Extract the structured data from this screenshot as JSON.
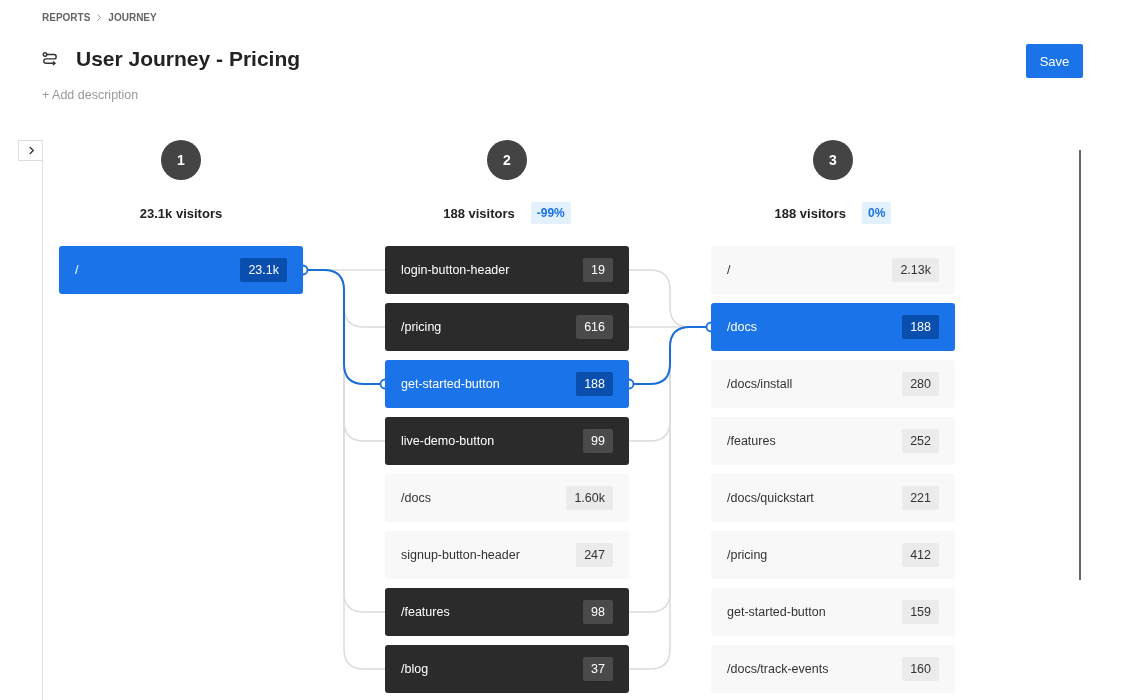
{
  "breadcrumb": [
    {
      "label": "REPORTS"
    },
    {
      "label": "JOURNEY"
    }
  ],
  "title": "User Journey - Pricing",
  "add_description": "+ Add description",
  "save_button": "Save",
  "steps": [
    {
      "number": "1",
      "visitors": "23.1k visitors",
      "nodes": [
        {
          "label": "/",
          "count": "23.1k",
          "kind": "selected"
        }
      ]
    },
    {
      "number": "2",
      "visitors": "188 visitors",
      "change": "-99%",
      "nodes": [
        {
          "label": "login-button-header",
          "count": "19",
          "kind": "linked"
        },
        {
          "label": "/pricing",
          "count": "616",
          "kind": "linked"
        },
        {
          "label": "get-started-button",
          "count": "188",
          "kind": "selected"
        },
        {
          "label": "live-demo-button",
          "count": "99",
          "kind": "linked"
        },
        {
          "label": "/docs",
          "count": "1.60k",
          "kind": "plain"
        },
        {
          "label": "signup-button-header",
          "count": "247",
          "kind": "plain"
        },
        {
          "label": "/features",
          "count": "98",
          "kind": "linked"
        },
        {
          "label": "/blog",
          "count": "37",
          "kind": "linked"
        }
      ]
    },
    {
      "number": "3",
      "visitors": "188 visitors",
      "change": "0%",
      "nodes": [
        {
          "label": "/",
          "count": "2.13k",
          "kind": "plain"
        },
        {
          "label": "/docs",
          "count": "188",
          "kind": "selected"
        },
        {
          "label": "/docs/install",
          "count": "280",
          "kind": "plain"
        },
        {
          "label": "/features",
          "count": "252",
          "kind": "plain"
        },
        {
          "label": "/docs/quickstart",
          "count": "221",
          "kind": "plain"
        },
        {
          "label": "/pricing",
          "count": "412",
          "kind": "plain"
        },
        {
          "label": "get-started-button",
          "count": "159",
          "kind": "plain"
        },
        {
          "label": "/docs/track-events",
          "count": "160",
          "kind": "plain"
        }
      ]
    }
  ]
}
